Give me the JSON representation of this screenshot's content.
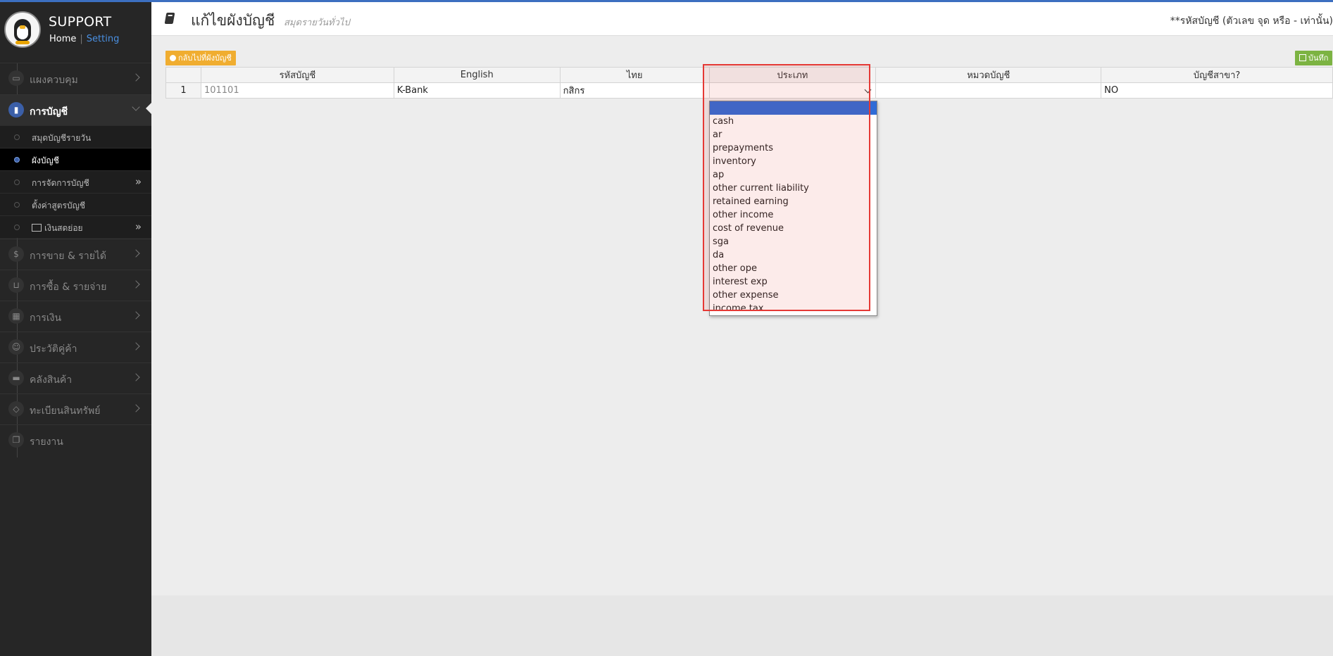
{
  "brand": {
    "title": "SUPPORT",
    "home": "Home",
    "setting": "Setting"
  },
  "sidebar": {
    "items": [
      {
        "label": "แผงควบคุม",
        "icon": "monitor-icon"
      },
      {
        "label": "การบัญชี",
        "icon": "book-icon"
      },
      {
        "label": "การขาย & รายได้",
        "icon": "dollar-icon"
      },
      {
        "label": "การซื้อ & รายจ่าย",
        "icon": "cart-icon"
      },
      {
        "label": "การเงิน",
        "icon": "calendar-icon"
      },
      {
        "label": "ประวัติคู่ค้า",
        "icon": "users-icon"
      },
      {
        "label": "คลังสินค้า",
        "icon": "truck-icon"
      },
      {
        "label": "ทะเบียนสินทรัพย์",
        "icon": "diamond-icon"
      },
      {
        "label": "รายงาน",
        "icon": "copy-icon"
      }
    ],
    "subitems": [
      {
        "label": "สมุดบัญชีรายวัน"
      },
      {
        "label": "ผังบัญชี"
      },
      {
        "label": "การจัดการบัญชี"
      },
      {
        "label": "ตั้งค่าสูตรบัญชี"
      },
      {
        "label": "เงินสดย่อย"
      }
    ]
  },
  "header": {
    "title": "แก้ไขผังบัญชี",
    "subtitle": "สมุดรายวันทั่วไป",
    "note": "**รหัสบัญชี (ตัวเลข จุด หรือ - เท่านั้น)"
  },
  "buttons": {
    "back": "กลับไปที่ผังบัญชี",
    "save": "บันทึก"
  },
  "table": {
    "headers": [
      "",
      "รหัสบัญชี",
      "English",
      "ไทย",
      "ประเภท",
      "หมวดบัญชี",
      "บัญชีสาขา?"
    ],
    "rows": [
      {
        "num": "1",
        "code": "101101",
        "english": "K-Bank",
        "thai": "กสิกร",
        "type": "",
        "category": "",
        "branch": "NO"
      }
    ]
  },
  "dropdown": {
    "options": [
      "",
      "cash",
      "ar",
      "prepayments",
      "inventory",
      "ap",
      "other current liability",
      "retained earning",
      "other income",
      "cost of revenue",
      "sga",
      "da",
      "other ope",
      "interest exp",
      "other expense",
      "income tax"
    ]
  }
}
